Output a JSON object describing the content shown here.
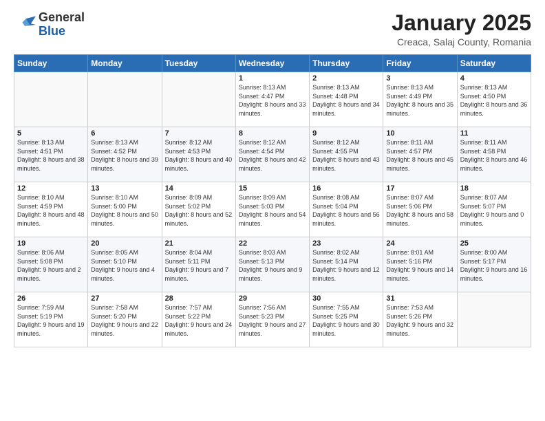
{
  "logo": {
    "general": "General",
    "blue": "Blue"
  },
  "header": {
    "title": "January 2025",
    "subtitle": "Creaca, Salaj County, Romania"
  },
  "weekdays": [
    "Sunday",
    "Monday",
    "Tuesday",
    "Wednesday",
    "Thursday",
    "Friday",
    "Saturday"
  ],
  "weeks": [
    [
      {
        "day": "",
        "sunrise": "",
        "sunset": "",
        "daylight": ""
      },
      {
        "day": "",
        "sunrise": "",
        "sunset": "",
        "daylight": ""
      },
      {
        "day": "",
        "sunrise": "",
        "sunset": "",
        "daylight": ""
      },
      {
        "day": "1",
        "sunrise": "Sunrise: 8:13 AM",
        "sunset": "Sunset: 4:47 PM",
        "daylight": "Daylight: 8 hours and 33 minutes."
      },
      {
        "day": "2",
        "sunrise": "Sunrise: 8:13 AM",
        "sunset": "Sunset: 4:48 PM",
        "daylight": "Daylight: 8 hours and 34 minutes."
      },
      {
        "day": "3",
        "sunrise": "Sunrise: 8:13 AM",
        "sunset": "Sunset: 4:49 PM",
        "daylight": "Daylight: 8 hours and 35 minutes."
      },
      {
        "day": "4",
        "sunrise": "Sunrise: 8:13 AM",
        "sunset": "Sunset: 4:50 PM",
        "daylight": "Daylight: 8 hours and 36 minutes."
      }
    ],
    [
      {
        "day": "5",
        "sunrise": "Sunrise: 8:13 AM",
        "sunset": "Sunset: 4:51 PM",
        "daylight": "Daylight: 8 hours and 38 minutes."
      },
      {
        "day": "6",
        "sunrise": "Sunrise: 8:13 AM",
        "sunset": "Sunset: 4:52 PM",
        "daylight": "Daylight: 8 hours and 39 minutes."
      },
      {
        "day": "7",
        "sunrise": "Sunrise: 8:12 AM",
        "sunset": "Sunset: 4:53 PM",
        "daylight": "Daylight: 8 hours and 40 minutes."
      },
      {
        "day": "8",
        "sunrise": "Sunrise: 8:12 AM",
        "sunset": "Sunset: 4:54 PM",
        "daylight": "Daylight: 8 hours and 42 minutes."
      },
      {
        "day": "9",
        "sunrise": "Sunrise: 8:12 AM",
        "sunset": "Sunset: 4:55 PM",
        "daylight": "Daylight: 8 hours and 43 minutes."
      },
      {
        "day": "10",
        "sunrise": "Sunrise: 8:11 AM",
        "sunset": "Sunset: 4:57 PM",
        "daylight": "Daylight: 8 hours and 45 minutes."
      },
      {
        "day": "11",
        "sunrise": "Sunrise: 8:11 AM",
        "sunset": "Sunset: 4:58 PM",
        "daylight": "Daylight: 8 hours and 46 minutes."
      }
    ],
    [
      {
        "day": "12",
        "sunrise": "Sunrise: 8:10 AM",
        "sunset": "Sunset: 4:59 PM",
        "daylight": "Daylight: 8 hours and 48 minutes."
      },
      {
        "day": "13",
        "sunrise": "Sunrise: 8:10 AM",
        "sunset": "Sunset: 5:00 PM",
        "daylight": "Daylight: 8 hours and 50 minutes."
      },
      {
        "day": "14",
        "sunrise": "Sunrise: 8:09 AM",
        "sunset": "Sunset: 5:02 PM",
        "daylight": "Daylight: 8 hours and 52 minutes."
      },
      {
        "day": "15",
        "sunrise": "Sunrise: 8:09 AM",
        "sunset": "Sunset: 5:03 PM",
        "daylight": "Daylight: 8 hours and 54 minutes."
      },
      {
        "day": "16",
        "sunrise": "Sunrise: 8:08 AM",
        "sunset": "Sunset: 5:04 PM",
        "daylight": "Daylight: 8 hours and 56 minutes."
      },
      {
        "day": "17",
        "sunrise": "Sunrise: 8:07 AM",
        "sunset": "Sunset: 5:06 PM",
        "daylight": "Daylight: 8 hours and 58 minutes."
      },
      {
        "day": "18",
        "sunrise": "Sunrise: 8:07 AM",
        "sunset": "Sunset: 5:07 PM",
        "daylight": "Daylight: 9 hours and 0 minutes."
      }
    ],
    [
      {
        "day": "19",
        "sunrise": "Sunrise: 8:06 AM",
        "sunset": "Sunset: 5:08 PM",
        "daylight": "Daylight: 9 hours and 2 minutes."
      },
      {
        "day": "20",
        "sunrise": "Sunrise: 8:05 AM",
        "sunset": "Sunset: 5:10 PM",
        "daylight": "Daylight: 9 hours and 4 minutes."
      },
      {
        "day": "21",
        "sunrise": "Sunrise: 8:04 AM",
        "sunset": "Sunset: 5:11 PM",
        "daylight": "Daylight: 9 hours and 7 minutes."
      },
      {
        "day": "22",
        "sunrise": "Sunrise: 8:03 AM",
        "sunset": "Sunset: 5:13 PM",
        "daylight": "Daylight: 9 hours and 9 minutes."
      },
      {
        "day": "23",
        "sunrise": "Sunrise: 8:02 AM",
        "sunset": "Sunset: 5:14 PM",
        "daylight": "Daylight: 9 hours and 12 minutes."
      },
      {
        "day": "24",
        "sunrise": "Sunrise: 8:01 AM",
        "sunset": "Sunset: 5:16 PM",
        "daylight": "Daylight: 9 hours and 14 minutes."
      },
      {
        "day": "25",
        "sunrise": "Sunrise: 8:00 AM",
        "sunset": "Sunset: 5:17 PM",
        "daylight": "Daylight: 9 hours and 16 minutes."
      }
    ],
    [
      {
        "day": "26",
        "sunrise": "Sunrise: 7:59 AM",
        "sunset": "Sunset: 5:19 PM",
        "daylight": "Daylight: 9 hours and 19 minutes."
      },
      {
        "day": "27",
        "sunrise": "Sunrise: 7:58 AM",
        "sunset": "Sunset: 5:20 PM",
        "daylight": "Daylight: 9 hours and 22 minutes."
      },
      {
        "day": "28",
        "sunrise": "Sunrise: 7:57 AM",
        "sunset": "Sunset: 5:22 PM",
        "daylight": "Daylight: 9 hours and 24 minutes."
      },
      {
        "day": "29",
        "sunrise": "Sunrise: 7:56 AM",
        "sunset": "Sunset: 5:23 PM",
        "daylight": "Daylight: 9 hours and 27 minutes."
      },
      {
        "day": "30",
        "sunrise": "Sunrise: 7:55 AM",
        "sunset": "Sunset: 5:25 PM",
        "daylight": "Daylight: 9 hours and 30 minutes."
      },
      {
        "day": "31",
        "sunrise": "Sunrise: 7:53 AM",
        "sunset": "Sunset: 5:26 PM",
        "daylight": "Daylight: 9 hours and 32 minutes."
      },
      {
        "day": "",
        "sunrise": "",
        "sunset": "",
        "daylight": ""
      }
    ]
  ]
}
